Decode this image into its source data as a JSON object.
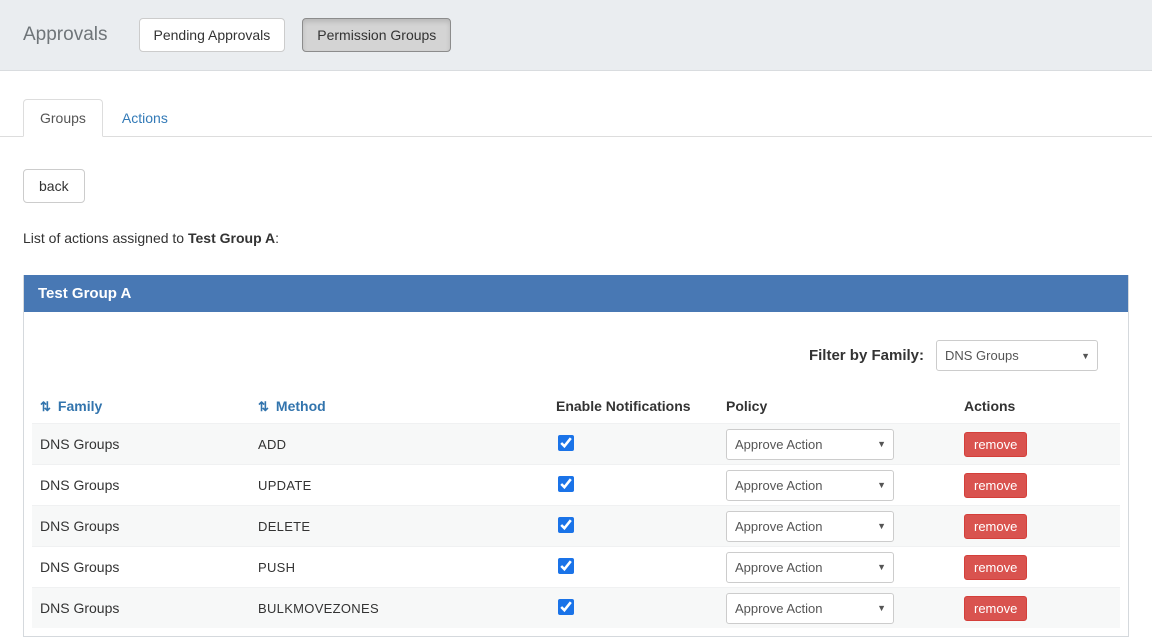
{
  "header": {
    "title": "Approvals",
    "pending_button": "Pending Approvals",
    "permission_button": "Permission Groups"
  },
  "tabs": {
    "groups": "Groups",
    "actions": "Actions"
  },
  "back_button": "back",
  "intro": {
    "prefix": "List of actions assigned to ",
    "group": "Test Group A",
    "suffix": ":"
  },
  "panel": {
    "title": "Test Group A",
    "filter": {
      "label": "Filter by Family:",
      "selected": "DNS Groups"
    }
  },
  "table": {
    "sort_icon": "⇅",
    "caret_icon": "▼",
    "headers": {
      "family": "Family",
      "method": "Method",
      "notifications": "Enable Notifications",
      "policy": "Policy",
      "actions": "Actions"
    },
    "rows": [
      {
        "family": "DNS Groups",
        "method": "ADD",
        "notifications_checked": true,
        "policy_selected": "Approve Action",
        "remove_label": "remove"
      },
      {
        "family": "DNS Groups",
        "method": "UPDATE",
        "notifications_checked": true,
        "policy_selected": "Approve Action",
        "remove_label": "remove"
      },
      {
        "family": "DNS Groups",
        "method": "DELETE",
        "notifications_checked": true,
        "policy_selected": "Approve Action",
        "remove_label": "remove"
      },
      {
        "family": "DNS Groups",
        "method": "PUSH",
        "notifications_checked": true,
        "policy_selected": "Approve Action",
        "remove_label": "remove"
      },
      {
        "family": "DNS Groups",
        "method": "BULKMOVEZONES",
        "notifications_checked": true,
        "policy_selected": "Approve Action",
        "remove_label": "remove"
      }
    ]
  },
  "colors": {
    "panel_header": "#4878b4",
    "link": "#337ab7",
    "danger": "#d9534f",
    "topbar_bg": "#eaedf0"
  }
}
